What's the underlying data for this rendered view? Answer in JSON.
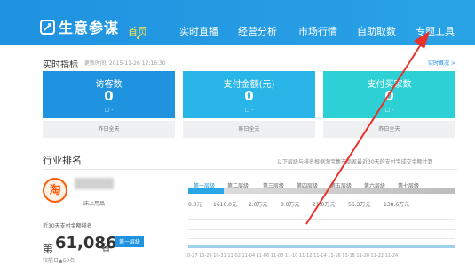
{
  "nav": {
    "logo_text": "生意参谋",
    "items": [
      "首页",
      "实时直播",
      "经营分析",
      "市场行情",
      "自助取数",
      "专题工具"
    ]
  },
  "indicators": {
    "title": "实时指标",
    "update_time": "更新时间: 2015-11-26 12:16:30",
    "more_link": "实时概况 >"
  },
  "cards": [
    {
      "label": "访客数",
      "value": "0",
      "sub": "□ -",
      "foot": "昨日全天",
      "color": "#1f92e0"
    },
    {
      "label": "支付金额(元)",
      "value": "0",
      "sub": "□ -",
      "foot": "昨日全天",
      "color": "#29b5e8"
    },
    {
      "label": "支付买家数",
      "value": "0",
      "sub": "□ -",
      "foot": "昨日全天",
      "color": "#2dd0d5"
    }
  ],
  "ranking": {
    "title": "行业排名",
    "note": "以下层级与排名根据淘宝集市商家最近30天的支付宝成交金额计算",
    "logo_char": "淘",
    "shop_sub": "床上用品",
    "caption": "近30天支付金额排名",
    "prefix": "第",
    "rank": "61,086",
    "suffix": "名",
    "badge": "第一层级",
    "prev": "较前日▲60名"
  },
  "tiers": [
    "第一层级",
    "第二层级",
    "第三层级",
    "第四层级",
    "第五层级",
    "第六层级",
    "第七层级"
  ],
  "tier_values": [
    "0.0元",
    "1610.0元",
    "2.0万元",
    "0.0万元",
    "21.0万元",
    "56.3万元",
    "138.6万元"
  ],
  "dates": "10-27 10-29 10-31 11-02 11-04 11-06 11-08 11-10 11-12 11-14 11-16 11-18 11-20 11-22 11-24",
  "colors": {
    "nav": "#1f92e0",
    "active_nav": "#f6e14f",
    "arrow": "#e8322b"
  }
}
